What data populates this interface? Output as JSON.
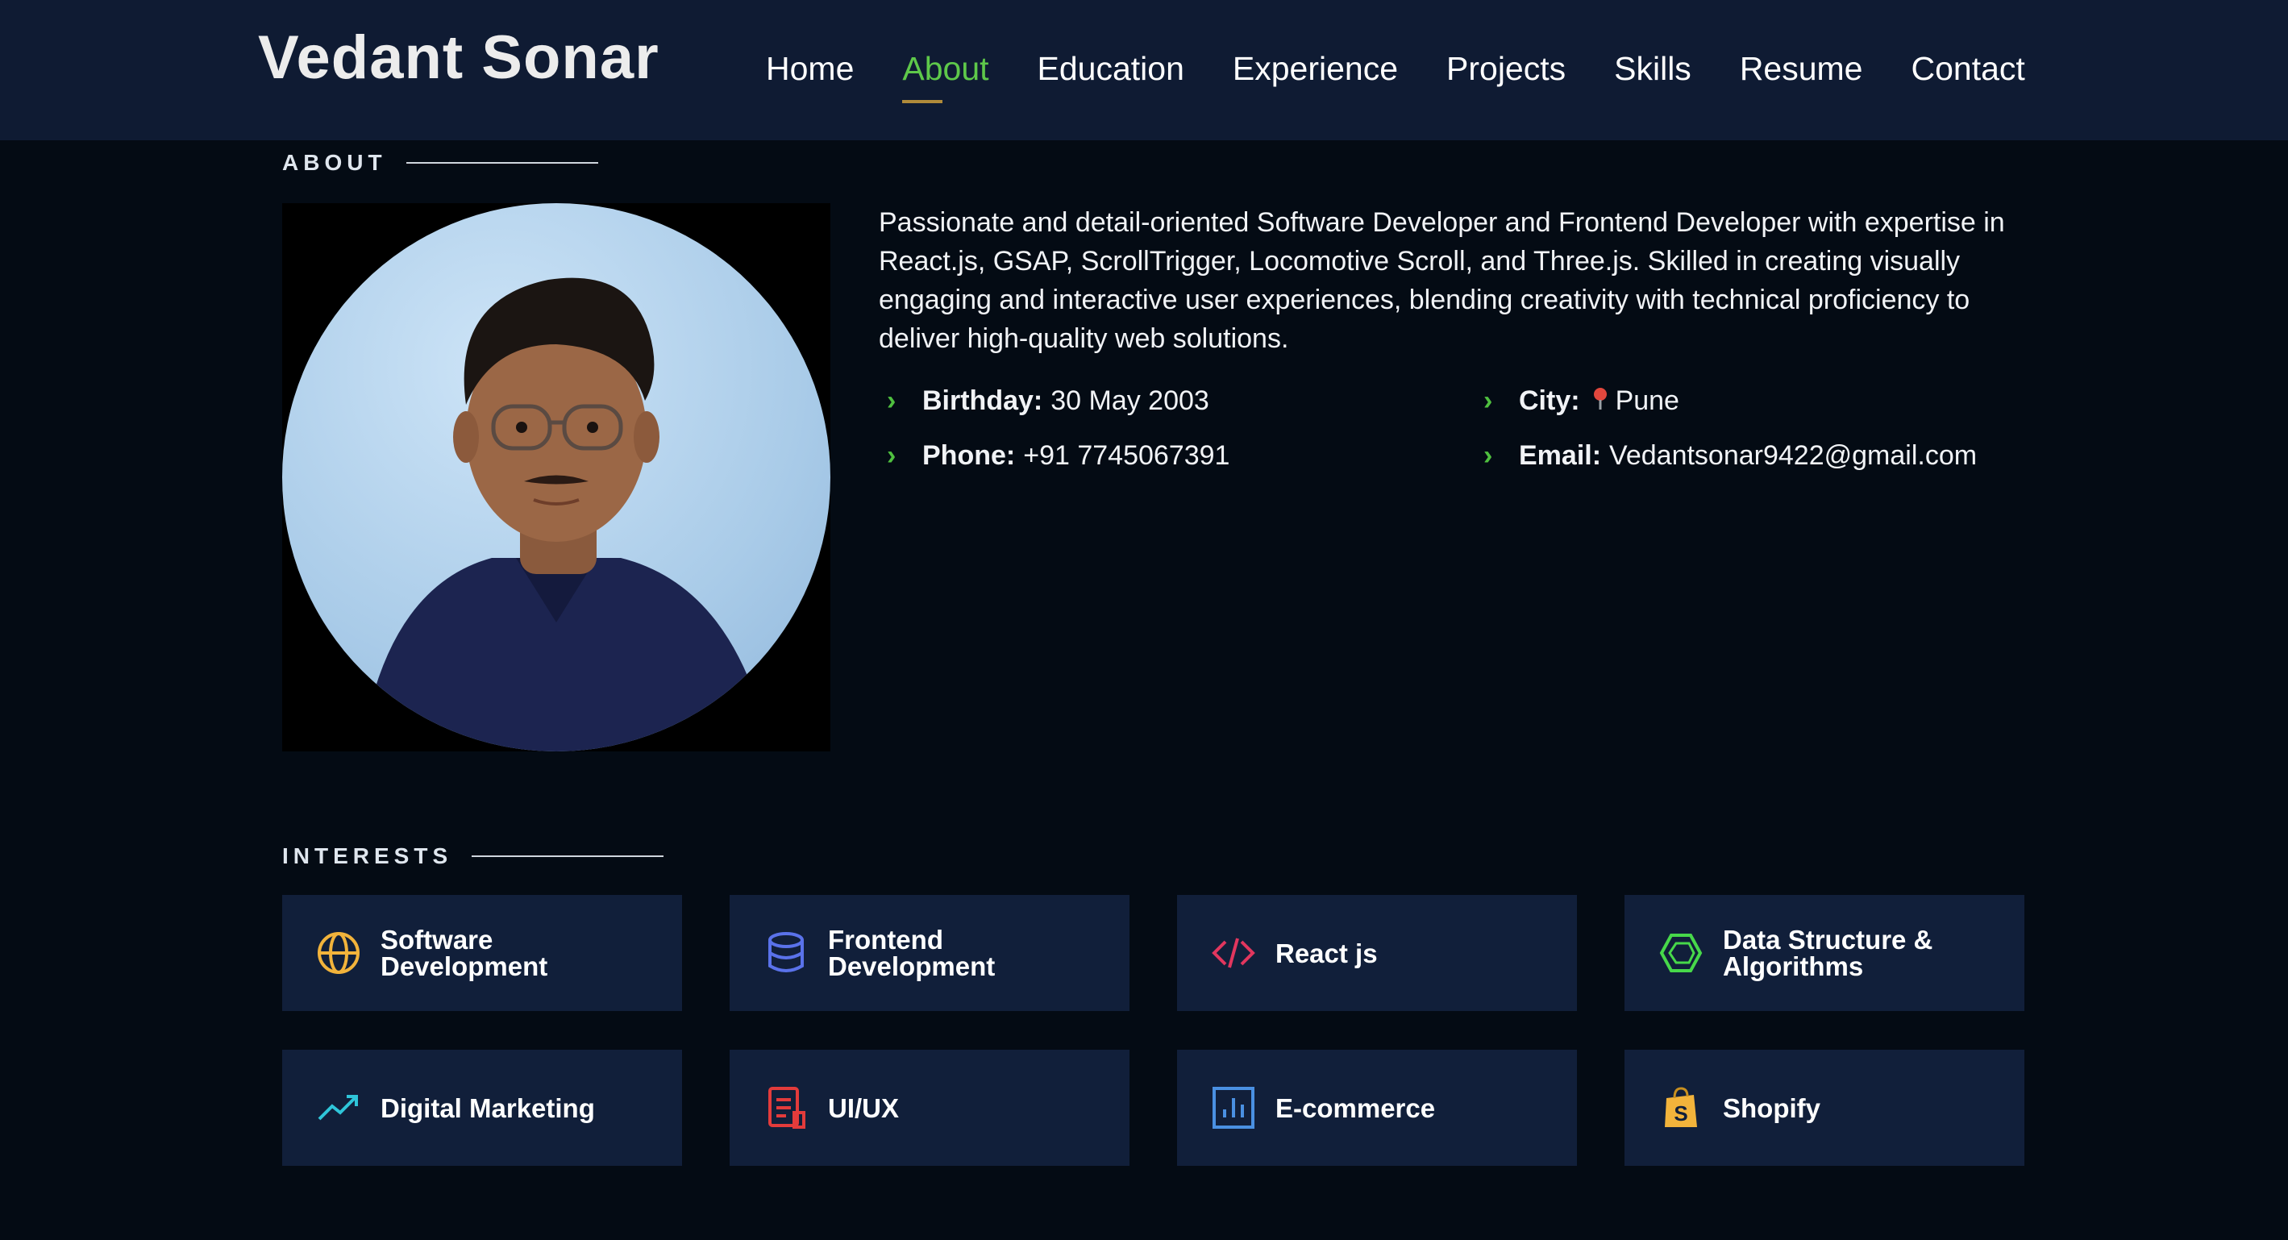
{
  "header": {
    "brand": "Vedant Sonar",
    "nav": [
      {
        "label": "Home"
      },
      {
        "label": "About"
      },
      {
        "label": "Education"
      },
      {
        "label": "Experience"
      },
      {
        "label": "Projects"
      },
      {
        "label": "Skills"
      },
      {
        "label": "Resume"
      },
      {
        "label": "Contact"
      }
    ],
    "active_nav": "About",
    "active_color": "#5ec84a"
  },
  "about": {
    "section_title": "ABOUT",
    "bio": "Passionate and detail-oriented Software Developer and Frontend Developer with expertise in React.js, GSAP, ScrollTrigger, Locomotive Scroll, and Three.js. Skilled in creating visually engaging and interactive user experiences, blending creativity with technical proficiency to deliver high-quality web solutions.",
    "details": {
      "birthday_label": "Birthday:",
      "birthday_value": "30 May 2003",
      "city_label": "City:",
      "city_value": "Pune",
      "phone_label": "Phone:",
      "phone_value": "+91 7745067391",
      "email_label": "Email:",
      "email_value": "Vedantsonar9422@gmail.com"
    }
  },
  "interests": {
    "section_title": "INTERESTS",
    "items": [
      {
        "line1": "Software",
        "line2": "Development",
        "icon": "globe-icon",
        "color": "#f2b33b"
      },
      {
        "line1": "Frontend",
        "line2": "Development",
        "icon": "database-icon",
        "color": "#5a72ea"
      },
      {
        "line1": "React js",
        "line2": "",
        "icon": "code-icon",
        "color": "#e2365e"
      },
      {
        "line1": "Data Structure &",
        "line2": "Algorithms",
        "icon": "hexagon-icon",
        "color": "#47d84a"
      },
      {
        "line1": "Digital Marketing",
        "line2": "",
        "icon": "trending-up-icon",
        "color": "#2fc5d9"
      },
      {
        "line1": "UI/UX",
        "line2": "",
        "icon": "document-icon",
        "color": "#e33b3b"
      },
      {
        "line1": "E-commerce",
        "line2": "",
        "icon": "bar-chart-icon",
        "color": "#4a90e2"
      },
      {
        "line1": "Shopify",
        "line2": "",
        "icon": "shopify-bag-icon",
        "color": "#f2b33b"
      }
    ]
  }
}
